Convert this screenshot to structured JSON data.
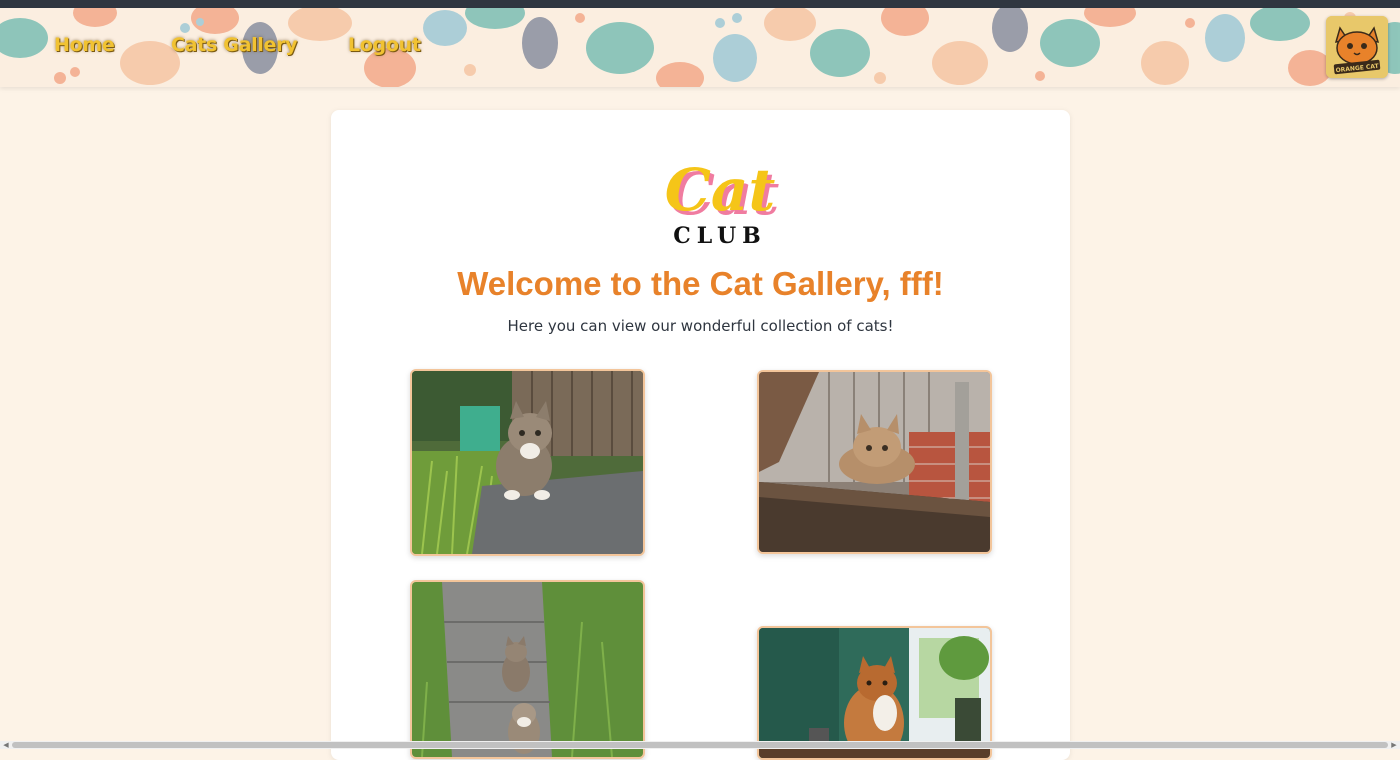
{
  "nav": {
    "home": "Home",
    "gallery": "Cats Gallery",
    "logout": "Logout",
    "badge_text": "ORANGE CAT"
  },
  "logo": {
    "word": "Cat",
    "sub": "CLUB"
  },
  "welcome": "Welcome to the Cat Gallery, fff!",
  "subtitle": "Here you can view our wonderful collection of cats!",
  "photos": [
    "tabby-cat-by-grass",
    "tabby-cat-on-wood-ledge",
    "two-cats-on-garden-path",
    "fluffy-cat-by-window"
  ],
  "colors": {
    "accent": "#e8822a",
    "nav_text": "#f1c232",
    "background": "#fdf3e7"
  }
}
